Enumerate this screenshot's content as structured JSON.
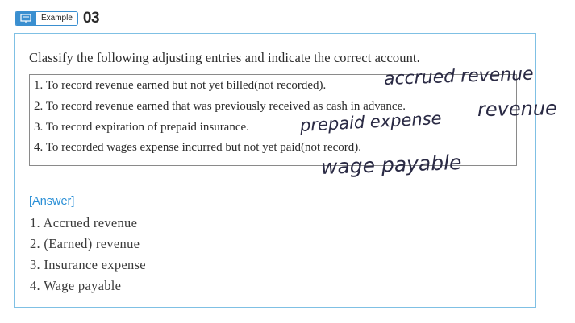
{
  "header": {
    "badge_label": "Example",
    "number": "03"
  },
  "question": "Classify the following adjusting entries and indicate the correct account.",
  "items": [
    "1. To record revenue earned but not yet billed(not recorded).",
    "2. To record revenue earned that was previously received as cash in advance.",
    "3. To record expiration of prepaid insurance.",
    "4. To recorded wages expense incurred but not yet paid(not record)."
  ],
  "handwritten": [
    "accrued revenue",
    "revenue",
    "prepaid expense",
    "wage payable"
  ],
  "answer": {
    "label": "[Answer]",
    "items": [
      "1. Accrued revenue",
      "2. (Earned) revenue",
      "3. Insurance expense",
      "4. Wage payable"
    ]
  },
  "colors": {
    "accent": "#3a8fd0",
    "card_border": "#7fc0e4",
    "answer_label": "#2a8fd6"
  }
}
